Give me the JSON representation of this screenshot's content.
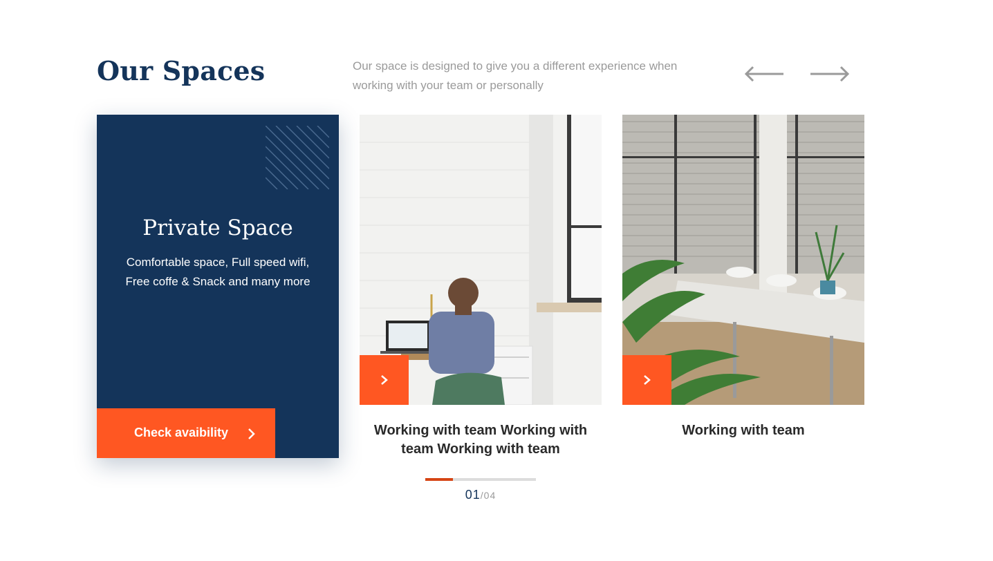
{
  "header": {
    "title": "Our Spaces",
    "subtitle": "Our space is designed to give you a different experience when working with your team or personally",
    "prev_icon": "arrow-left-icon",
    "next_icon": "arrow-right-icon"
  },
  "featured": {
    "title": "Private Space",
    "description": "Comfortable space, Full speed wifi, Free coffe & Snack and many more",
    "cta_label": "Check avaibility",
    "cta_icon": "chevron-right-icon"
  },
  "cards": [
    {
      "caption": "Working with team Working with team Working with team",
      "button_icon": "chevron-right-icon"
    },
    {
      "caption": "Working with team",
      "button_icon": "chevron-right-icon"
    }
  ],
  "pagination": {
    "current": "01",
    "separator": "/",
    "total": "04",
    "progress": 0.25
  },
  "colors": {
    "navy": "#14345a",
    "accent": "#ff5722",
    "muted": "#9a9a9a"
  }
}
